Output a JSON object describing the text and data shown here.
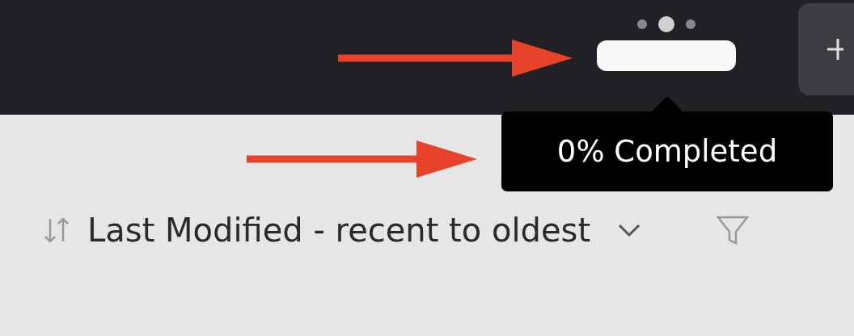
{
  "header": {
    "page_dots": [
      {
        "selected": false
      },
      {
        "selected": true
      },
      {
        "selected": false
      }
    ]
  },
  "tooltip": {
    "text": "0% Completed"
  },
  "sort": {
    "label": "Last Modified - recent to oldest"
  }
}
